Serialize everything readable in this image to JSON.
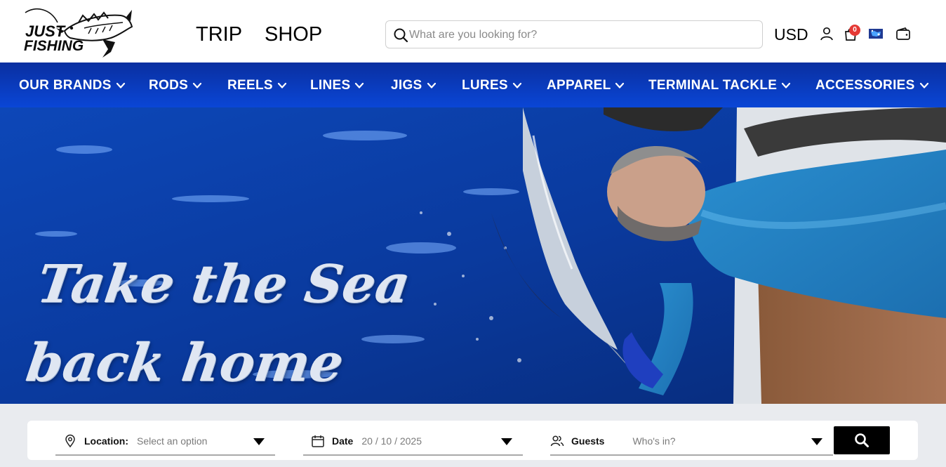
{
  "header": {
    "logo": {
      "line1": "JUST",
      "line2": "FISHING"
    },
    "links": {
      "trip": "TRIP",
      "shop": "SHOP"
    },
    "search": {
      "placeholder": "What are you looking for?",
      "value": ""
    },
    "currency": "USD",
    "cart": {
      "count": "0"
    },
    "icons": [
      "search-icon",
      "user-icon",
      "cart-icon",
      "flag-icon",
      "wallet-icon"
    ]
  },
  "nav": {
    "items": [
      {
        "label": "OUR BRANDS"
      },
      {
        "label": "RODS"
      },
      {
        "label": "REELS"
      },
      {
        "label": "LINES"
      },
      {
        "label": "JIGS"
      },
      {
        "label": "LURES"
      },
      {
        "label": "APPAREL"
      },
      {
        "label": "TERMINAL TACKLE"
      },
      {
        "label": "ACCESSORIES"
      }
    ],
    "colors": {
      "top": "#0a2fa0",
      "bottom": "#0a46d6",
      "text": "#ffffff"
    }
  },
  "hero": {
    "title_line1": "Take the Sea",
    "title_line2": "back home"
  },
  "booking": {
    "location": {
      "label": "Location:",
      "value": "Select an option"
    },
    "date": {
      "label": "Date",
      "value": "20 / 10 / 2025"
    },
    "guests": {
      "label": "Guests",
      "value": "Who's in?"
    }
  }
}
